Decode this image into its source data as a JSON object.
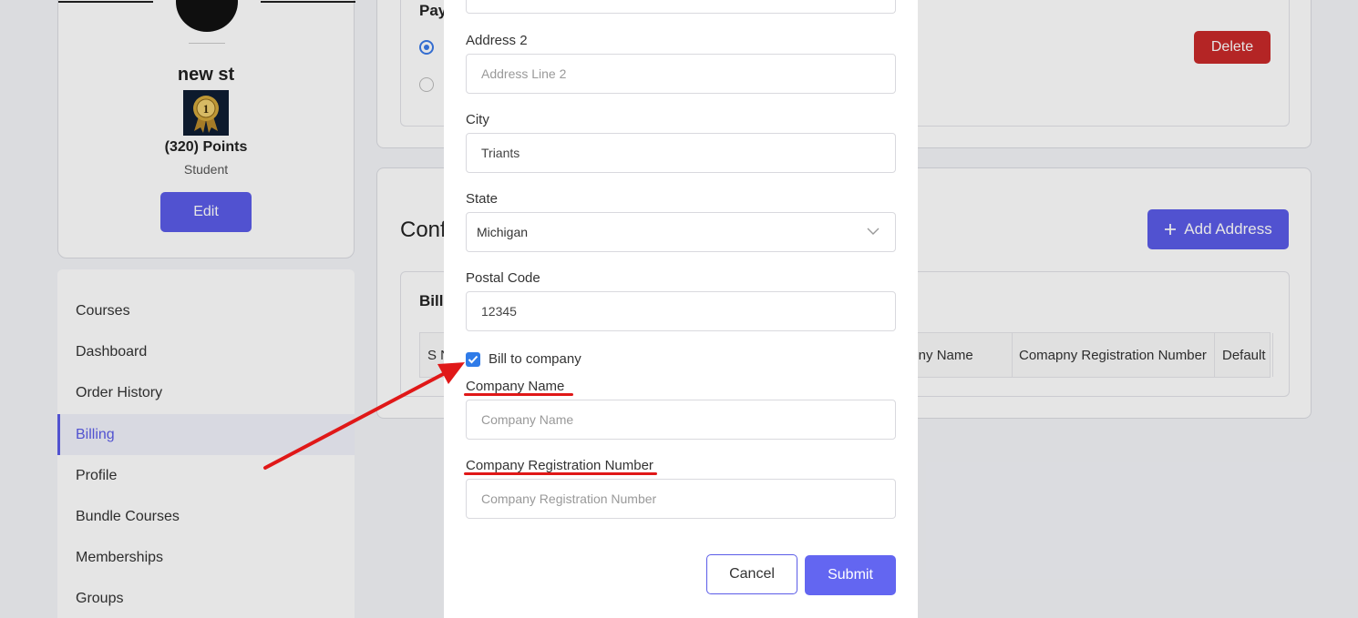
{
  "profile": {
    "name": "new st",
    "badge_number": "1",
    "points": "(320) Points",
    "role": "Student",
    "edit_label": "Edit"
  },
  "sidebar": {
    "items": [
      {
        "label": "Courses"
      },
      {
        "label": "Dashboard"
      },
      {
        "label": "Order History"
      },
      {
        "label": "Billing",
        "active": true
      },
      {
        "label": "Profile"
      },
      {
        "label": "Bundle Courses"
      },
      {
        "label": "Memberships"
      },
      {
        "label": "Groups"
      }
    ]
  },
  "payment": {
    "title": "Pay",
    "delete_label": "Delete"
  },
  "addresses": {
    "title": "Conf",
    "add_label": "Add Address",
    "table_title": "Bill",
    "columns": [
      "S N",
      "apny Name",
      "Comapny Registration Number",
      "Default"
    ]
  },
  "modal": {
    "address2": {
      "label": "Address 2",
      "placeholder": "Address Line 2",
      "value": ""
    },
    "city": {
      "label": "City",
      "value": "Triants"
    },
    "state": {
      "label": "State",
      "value": "Michigan"
    },
    "postal": {
      "label": "Postal Code",
      "value": "12345"
    },
    "bill_to_company": {
      "label": "Bill to company",
      "checked": true
    },
    "company_name": {
      "label": "Company Name",
      "placeholder": "Company Name",
      "value": ""
    },
    "company_reg": {
      "label": "Company Registration Number",
      "placeholder": "Company Registration Number",
      "value": ""
    },
    "cancel_label": "Cancel",
    "submit_label": "Submit"
  },
  "colors": {
    "primary": "#5b5ce8",
    "danger": "#c92a2a",
    "annotation": "#e01818",
    "checkbox": "#2f7be8"
  }
}
